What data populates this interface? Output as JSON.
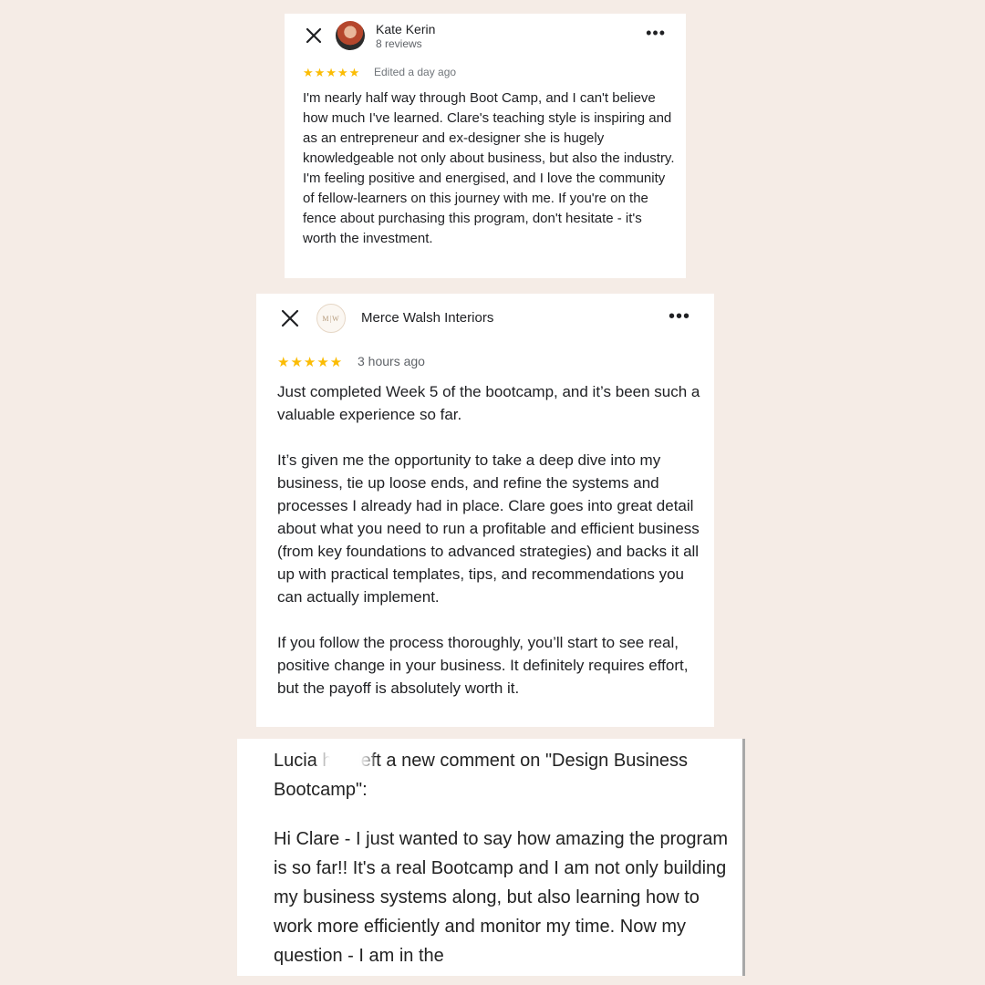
{
  "review1": {
    "author": "Kate Kerin",
    "subtitle": "8 reviews",
    "stars": "★★★★★",
    "meta": "Edited a day ago",
    "more_icon": "•••",
    "text": "I'm nearly half way through Boot Camp, and I can't believe how much I've learned. Clare's teaching style is inspiring and as an entrepreneur and ex-designer she is hugely knowledgeable not only about business, but also the industry. I'm feeling positive and energised, and I love the community of fellow-learners on this journey with me. If you're on the fence about purchasing this program, don't hesitate - it's worth the investment."
  },
  "review2": {
    "author": "Merce Walsh Interiors",
    "logo_text": "M|W",
    "stars": "★★★★★",
    "meta": "3 hours ago",
    "more_icon": "•••",
    "paragraphs": [
      "Just completed Week 5 of the bootcamp, and it’s been such a valuable experience so far.",
      "It’s given me the opportunity to take a deep dive into my business, tie up loose ends, and refine the systems and processes I already had in place. Clare goes into great detail about what you need to run a profitable and efficient business (from key foundations to advanced strategies) and backs it all up with practical templates, tips, and recommendations you can actually implement.",
      "If you follow the process thoroughly, you’ll start to see real, positive change in your business. It definitely requires effort, but the payoff is absolutely worth it."
    ]
  },
  "comment": {
    "header": "Lucia has left a new comment on \"Design Business Bootcamp\":",
    "text": "Hi Clare - I just wanted to say how amazing the program is so far!! It's a real Bootcamp and I am not only building my business systems along, but also learning how to work more efficiently and monitor my time. Now my question - I am in the"
  },
  "colors": {
    "background": "#f5ece6",
    "star": "#fbbc04",
    "card": "#ffffff"
  }
}
